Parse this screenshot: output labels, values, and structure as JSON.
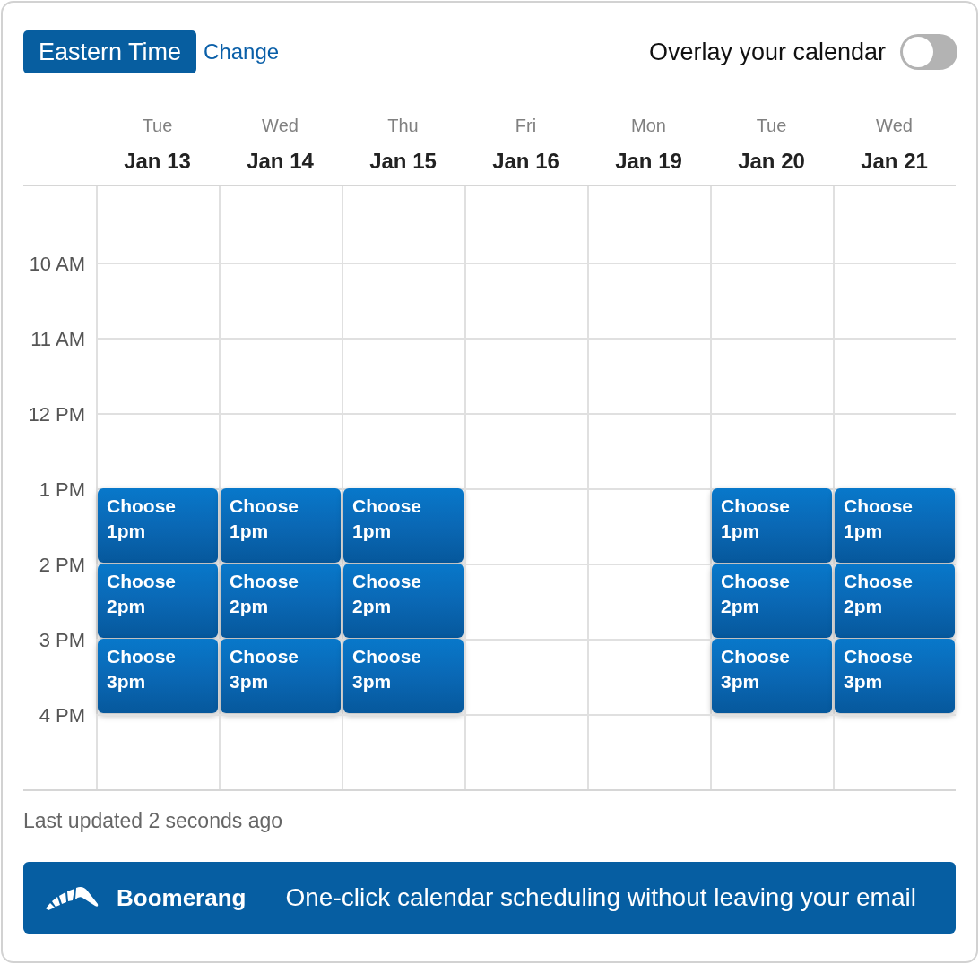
{
  "timezone": {
    "label": "Eastern Time",
    "link": "Change"
  },
  "overlay": {
    "label": "Overlay your calendar",
    "on": false
  },
  "days": [
    {
      "weekday": "Tue",
      "date": "Jan 13"
    },
    {
      "weekday": "Wed",
      "date": "Jan 14"
    },
    {
      "weekday": "Thu",
      "date": "Jan 15"
    },
    {
      "weekday": "Fri",
      "date": "Jan 16"
    },
    {
      "weekday": "Mon",
      "date": "Jan 19"
    },
    {
      "weekday": "Tue",
      "date": "Jan 20"
    },
    {
      "weekday": "Wed",
      "date": "Jan 21"
    }
  ],
  "rows": [
    {
      "cells": [
        {
          "kind": "empty"
        },
        {
          "kind": "empty"
        },
        {
          "kind": "empty"
        },
        {
          "kind": "empty"
        },
        {
          "kind": "empty"
        },
        {
          "kind": "empty"
        },
        {
          "kind": "empty"
        }
      ]
    },
    {
      "time": "10 AM",
      "cells": [
        {
          "kind": "empty"
        },
        {
          "kind": "empty"
        },
        {
          "kind": "empty"
        },
        {
          "kind": "empty"
        },
        {
          "kind": "empty"
        },
        {
          "kind": "empty"
        },
        {
          "kind": "empty"
        }
      ]
    },
    {
      "time": "11 AM",
      "cells": [
        {
          "kind": "empty"
        },
        {
          "kind": "empty"
        },
        {
          "kind": "empty"
        },
        {
          "kind": "empty"
        },
        {
          "kind": "empty"
        },
        {
          "kind": "empty"
        },
        {
          "kind": "empty"
        }
      ]
    },
    {
      "time": "12 PM",
      "cells": [
        {
          "kind": "empty"
        },
        {
          "kind": "empty"
        },
        {
          "kind": "empty"
        },
        {
          "kind": "empty"
        },
        {
          "kind": "empty"
        },
        {
          "kind": "empty"
        },
        {
          "kind": "empty"
        }
      ]
    },
    {
      "time": "1 PM",
      "cells": [
        {
          "kind": "slot",
          "label": "Choose 1pm"
        },
        {
          "kind": "slot",
          "label": "Choose 1pm"
        },
        {
          "kind": "slot",
          "label": "Choose 1pm"
        },
        {
          "kind": "empty"
        },
        {
          "kind": "empty"
        },
        {
          "kind": "slot",
          "label": "Choose 1pm"
        },
        {
          "kind": "slot",
          "label": "Choose 1pm"
        }
      ]
    },
    {
      "time": "2 PM",
      "cells": [
        {
          "kind": "slot",
          "label": "Choose 2pm"
        },
        {
          "kind": "slot",
          "label": "Choose 2pm"
        },
        {
          "kind": "slot",
          "label": "Choose 2pm"
        },
        {
          "kind": "empty"
        },
        {
          "kind": "empty"
        },
        {
          "kind": "slot",
          "label": "Choose 2pm"
        },
        {
          "kind": "slot",
          "label": "Choose 2pm"
        }
      ]
    },
    {
      "time": "3 PM",
      "cells": [
        {
          "kind": "slot",
          "label": "Choose 3pm"
        },
        {
          "kind": "slot",
          "label": "Choose 3pm"
        },
        {
          "kind": "slot",
          "label": "Choose 3pm"
        },
        {
          "kind": "empty"
        },
        {
          "kind": "empty"
        },
        {
          "kind": "slot",
          "label": "Choose 3pm"
        },
        {
          "kind": "slot",
          "label": "Choose 3pm"
        }
      ]
    },
    {
      "time": "4 PM",
      "cells": [
        {
          "kind": "empty"
        },
        {
          "kind": "empty"
        },
        {
          "kind": "empty"
        },
        {
          "kind": "empty"
        },
        {
          "kind": "empty"
        },
        {
          "kind": "empty"
        },
        {
          "kind": "empty"
        }
      ]
    }
  ],
  "status": "Last updated 2 seconds ago",
  "banner": {
    "brand": "Boomerang",
    "tagline": "One-click calendar scheduling without leaving your email"
  }
}
